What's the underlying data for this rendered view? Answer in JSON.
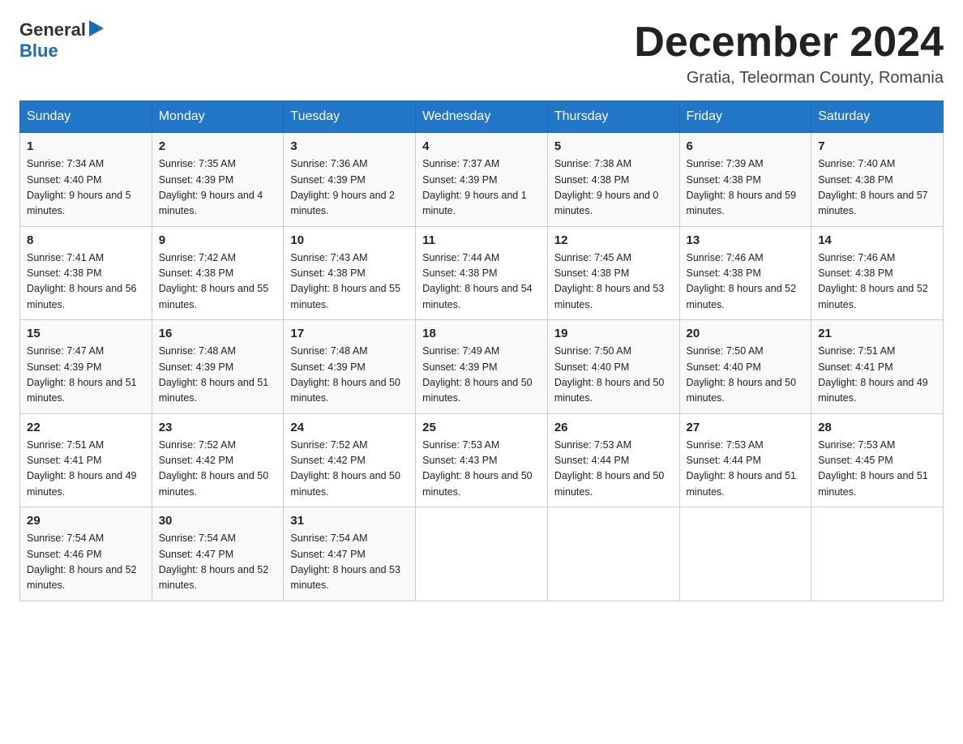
{
  "logo": {
    "general": "General",
    "triangle": "▶",
    "blue": "Blue"
  },
  "header": {
    "title": "December 2024",
    "location": "Gratia, Teleorman County, Romania"
  },
  "weekdays": [
    "Sunday",
    "Monday",
    "Tuesday",
    "Wednesday",
    "Thursday",
    "Friday",
    "Saturday"
  ],
  "weeks": [
    [
      {
        "day": "1",
        "sunrise": "7:34 AM",
        "sunset": "4:40 PM",
        "daylight": "9 hours and 5 minutes."
      },
      {
        "day": "2",
        "sunrise": "7:35 AM",
        "sunset": "4:39 PM",
        "daylight": "9 hours and 4 minutes."
      },
      {
        "day": "3",
        "sunrise": "7:36 AM",
        "sunset": "4:39 PM",
        "daylight": "9 hours and 2 minutes."
      },
      {
        "day": "4",
        "sunrise": "7:37 AM",
        "sunset": "4:39 PM",
        "daylight": "9 hours and 1 minute."
      },
      {
        "day": "5",
        "sunrise": "7:38 AM",
        "sunset": "4:38 PM",
        "daylight": "9 hours and 0 minutes."
      },
      {
        "day": "6",
        "sunrise": "7:39 AM",
        "sunset": "4:38 PM",
        "daylight": "8 hours and 59 minutes."
      },
      {
        "day": "7",
        "sunrise": "7:40 AM",
        "sunset": "4:38 PM",
        "daylight": "8 hours and 57 minutes."
      }
    ],
    [
      {
        "day": "8",
        "sunrise": "7:41 AM",
        "sunset": "4:38 PM",
        "daylight": "8 hours and 56 minutes."
      },
      {
        "day": "9",
        "sunrise": "7:42 AM",
        "sunset": "4:38 PM",
        "daylight": "8 hours and 55 minutes."
      },
      {
        "day": "10",
        "sunrise": "7:43 AM",
        "sunset": "4:38 PM",
        "daylight": "8 hours and 55 minutes."
      },
      {
        "day": "11",
        "sunrise": "7:44 AM",
        "sunset": "4:38 PM",
        "daylight": "8 hours and 54 minutes."
      },
      {
        "day": "12",
        "sunrise": "7:45 AM",
        "sunset": "4:38 PM",
        "daylight": "8 hours and 53 minutes."
      },
      {
        "day": "13",
        "sunrise": "7:46 AM",
        "sunset": "4:38 PM",
        "daylight": "8 hours and 52 minutes."
      },
      {
        "day": "14",
        "sunrise": "7:46 AM",
        "sunset": "4:38 PM",
        "daylight": "8 hours and 52 minutes."
      }
    ],
    [
      {
        "day": "15",
        "sunrise": "7:47 AM",
        "sunset": "4:39 PM",
        "daylight": "8 hours and 51 minutes."
      },
      {
        "day": "16",
        "sunrise": "7:48 AM",
        "sunset": "4:39 PM",
        "daylight": "8 hours and 51 minutes."
      },
      {
        "day": "17",
        "sunrise": "7:48 AM",
        "sunset": "4:39 PM",
        "daylight": "8 hours and 50 minutes."
      },
      {
        "day": "18",
        "sunrise": "7:49 AM",
        "sunset": "4:39 PM",
        "daylight": "8 hours and 50 minutes."
      },
      {
        "day": "19",
        "sunrise": "7:50 AM",
        "sunset": "4:40 PM",
        "daylight": "8 hours and 50 minutes."
      },
      {
        "day": "20",
        "sunrise": "7:50 AM",
        "sunset": "4:40 PM",
        "daylight": "8 hours and 50 minutes."
      },
      {
        "day": "21",
        "sunrise": "7:51 AM",
        "sunset": "4:41 PM",
        "daylight": "8 hours and 49 minutes."
      }
    ],
    [
      {
        "day": "22",
        "sunrise": "7:51 AM",
        "sunset": "4:41 PM",
        "daylight": "8 hours and 49 minutes."
      },
      {
        "day": "23",
        "sunrise": "7:52 AM",
        "sunset": "4:42 PM",
        "daylight": "8 hours and 50 minutes."
      },
      {
        "day": "24",
        "sunrise": "7:52 AM",
        "sunset": "4:42 PM",
        "daylight": "8 hours and 50 minutes."
      },
      {
        "day": "25",
        "sunrise": "7:53 AM",
        "sunset": "4:43 PM",
        "daylight": "8 hours and 50 minutes."
      },
      {
        "day": "26",
        "sunrise": "7:53 AM",
        "sunset": "4:44 PM",
        "daylight": "8 hours and 50 minutes."
      },
      {
        "day": "27",
        "sunrise": "7:53 AM",
        "sunset": "4:44 PM",
        "daylight": "8 hours and 51 minutes."
      },
      {
        "day": "28",
        "sunrise": "7:53 AM",
        "sunset": "4:45 PM",
        "daylight": "8 hours and 51 minutes."
      }
    ],
    [
      {
        "day": "29",
        "sunrise": "7:54 AM",
        "sunset": "4:46 PM",
        "daylight": "8 hours and 52 minutes."
      },
      {
        "day": "30",
        "sunrise": "7:54 AM",
        "sunset": "4:47 PM",
        "daylight": "8 hours and 52 minutes."
      },
      {
        "day": "31",
        "sunrise": "7:54 AM",
        "sunset": "4:47 PM",
        "daylight": "8 hours and 53 minutes."
      },
      null,
      null,
      null,
      null
    ]
  ]
}
